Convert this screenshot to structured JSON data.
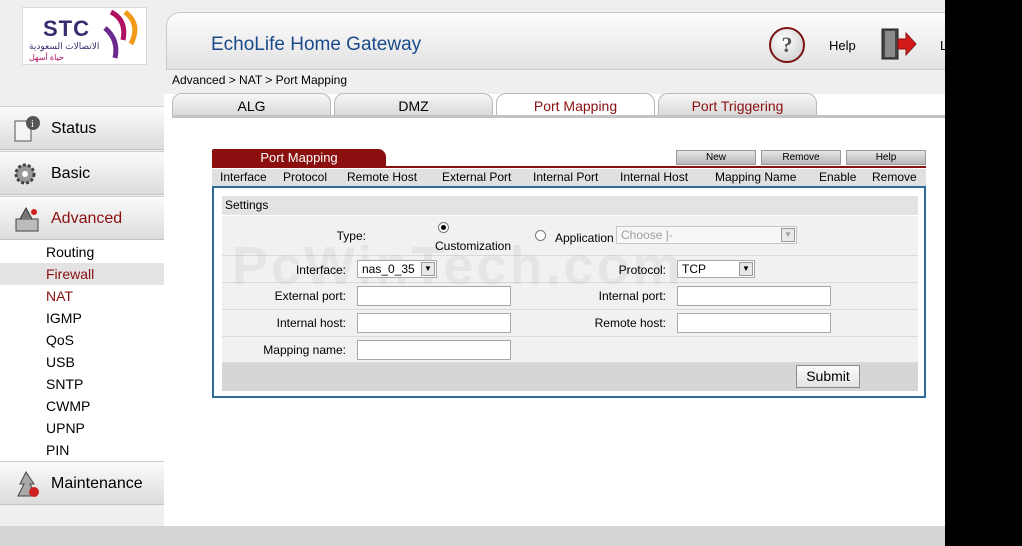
{
  "logo": {
    "brand": "STC",
    "arabic_line": "الاتصالات السعودية",
    "tagline": "حياة أسهل"
  },
  "header": {
    "title": "EchoLife Home Gateway",
    "help_label": "Help",
    "logout_label": "L"
  },
  "breadcrumb": "Advanced > NAT > Port Mapping",
  "tabs": [
    {
      "label": "ALG"
    },
    {
      "label": "DMZ"
    },
    {
      "label": "Port Mapping"
    },
    {
      "label": "Port Triggering"
    }
  ],
  "sidebar": {
    "menus": [
      {
        "label": "Status"
      },
      {
        "label": "Basic"
      },
      {
        "label": "Advanced"
      },
      {
        "label": "Maintenance"
      }
    ],
    "advanced_items": [
      {
        "label": "Routing"
      },
      {
        "label": "Firewall"
      },
      {
        "label": "NAT"
      },
      {
        "label": "IGMP"
      },
      {
        "label": "QoS"
      },
      {
        "label": "USB"
      },
      {
        "label": "SNTP"
      },
      {
        "label": "CWMP"
      },
      {
        "label": "UPNP"
      },
      {
        "label": "PIN"
      }
    ]
  },
  "port_mapping": {
    "title": "Port Mapping",
    "buttons": {
      "new": "New",
      "remove": "Remove",
      "help": "Help"
    },
    "columns": [
      "Interface",
      "Protocol",
      "Remote Host",
      "External Port",
      "Internal Port",
      "Internal Host",
      "Mapping Name",
      "Enable",
      "Remove"
    ],
    "settings": {
      "header": "Settings",
      "type_label": "Type:",
      "customization_label": "Customization",
      "application_label": "Application",
      "application_placeholder": "Choose |-",
      "interface_label": "Interface:",
      "interface_value": "nas_0_35",
      "protocol_label": "Protocol:",
      "protocol_value": "TCP",
      "external_port_label": "External port:",
      "external_port_value": "",
      "internal_port_label": "Internal port:",
      "internal_port_value": "",
      "internal_host_label": "Internal host:",
      "internal_host_value": "",
      "remote_host_label": "Remote host:",
      "remote_host_value": "",
      "mapping_name_label": "Mapping name:",
      "mapping_name_value": "",
      "submit_label": "Submit",
      "watermark": "PcWinTech.com"
    }
  },
  "colors": {
    "accent": "#8b0f0f",
    "title_blue": "#1a4a8a",
    "box_border": "#2d6b98"
  }
}
